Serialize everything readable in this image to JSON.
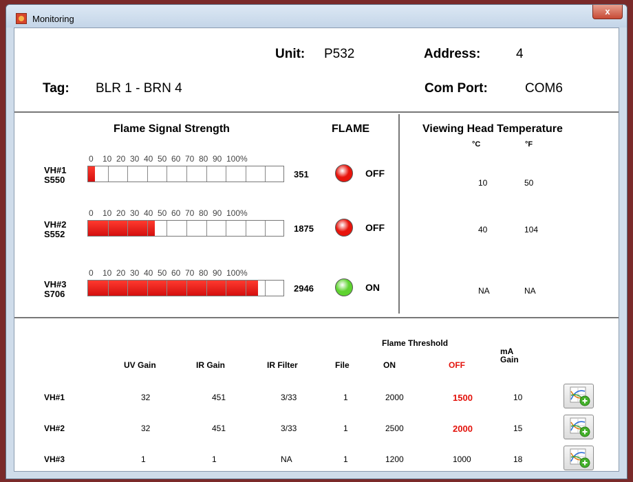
{
  "window": {
    "title": "Monitoring",
    "close_label": "x"
  },
  "header": {
    "unit_label": "Unit:",
    "unit_value": "P532",
    "address_label": "Address:",
    "address_value": "4",
    "tag_label": "Tag:",
    "tag_value": "BLR 1 - BRN 4",
    "comport_label": "Com Port:",
    "comport_value": "COM6"
  },
  "flame_signal": {
    "title": "Flame Signal Strength",
    "flame_title": "FLAME",
    "scale": [
      "0",
      "10",
      "20",
      "30",
      "40",
      "50",
      "60",
      "70",
      "80",
      "90",
      "100%"
    ],
    "rows": [
      {
        "vh": "VH#1",
        "sensor": "S550",
        "count": "351",
        "fill_percent": 3.5,
        "flame_state": "OFF",
        "led_color": "#e8140c"
      },
      {
        "vh": "VH#2",
        "sensor": "S552",
        "count": "1875",
        "fill_percent": 34,
        "flame_state": "OFF",
        "led_color": "#e8140c"
      },
      {
        "vh": "VH#3",
        "sensor": "S706",
        "count": "2946",
        "fill_percent": 87,
        "flame_state": "ON",
        "led_color": "#5fd330"
      }
    ]
  },
  "viewing_head": {
    "title": "Viewing Head Temperature",
    "c_label": "°C",
    "f_label": "°F",
    "rows": [
      {
        "c": "10",
        "f": "50"
      },
      {
        "c": "40",
        "f": "104"
      },
      {
        "c": "NA",
        "f": "NA"
      }
    ]
  },
  "settings": {
    "flame_threshold_label": "Flame Threshold",
    "columns": {
      "uv_gain": "UV Gain",
      "ir_gain": "IR Gain",
      "ir_filter": "IR Filter",
      "file": "File",
      "on": "ON",
      "off": "OFF",
      "ma_gain_line1": "mA",
      "ma_gain_line2": "Gain"
    },
    "rows": [
      {
        "vh": "VH#1",
        "uv_gain": "32",
        "ir_gain": "451",
        "ir_filter": "3/33",
        "file": "1",
        "on": "2000",
        "off": "1500",
        "off_highlight": true,
        "ma_gain": "10"
      },
      {
        "vh": "VH#2",
        "uv_gain": "32",
        "ir_gain": "451",
        "ir_filter": "3/33",
        "file": "1",
        "on": "2500",
        "off": "2000",
        "off_highlight": true,
        "ma_gain": "15"
      },
      {
        "vh": "VH#3",
        "uv_gain": "1",
        "ir_gain": "1",
        "ir_filter": "NA",
        "file": "1",
        "on": "1200",
        "off": "1000",
        "off_highlight": false,
        "ma_gain": "18"
      }
    ]
  },
  "colors": {
    "off_red": "#e3120b",
    "bar_red": "#e8140c",
    "led_on": "#5fd330",
    "led_off": "#e8140c"
  }
}
